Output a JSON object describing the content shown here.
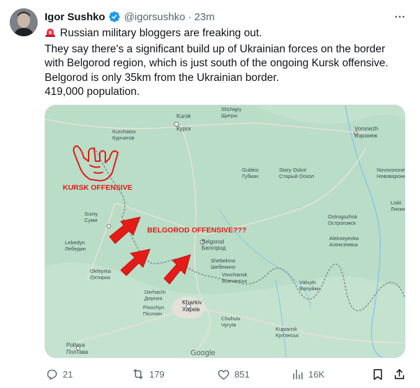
{
  "tweet": {
    "author_name": "Igor Sushko",
    "handle": "@igorsushko",
    "separator": "·",
    "time": "23m",
    "lines": [
      "Russian military bloggers are freaking out.",
      "They say there's a significant build up of Ukrainian forces on the border",
      "with Belgorod region, which is just south of the ongoing Kursk offensive.",
      "Belgorod is only 35km from the Ukrainian border.",
      "419,000 population."
    ]
  },
  "map": {
    "annotations": {
      "kursk": "KURSK OFFENSIVE",
      "belgorod": "BELGOROD OFFENSIVE???"
    },
    "attribution": "Google",
    "places": [
      {
        "id": "shchigry",
        "en": "Shchigry",
        "ru": "Щигры"
      },
      {
        "id": "kursk",
        "en": "Kursk",
        "ru": "Курск"
      },
      {
        "id": "kurchatov",
        "en": "Kurchatov",
        "ru": "Курчатов"
      },
      {
        "id": "voronezh",
        "en": "Voronezh",
        "ru": "Воронеж"
      },
      {
        "id": "gubkin",
        "en": "Gubkin",
        "ru": "Губкин"
      },
      {
        "id": "staryoskol",
        "en": "Stary Oskol",
        "ru": "Старый Оскол"
      },
      {
        "id": "novovoronezh",
        "en": "Novovoronezh",
        "ru": "Нововоронеж"
      },
      {
        "id": "liski",
        "en": "Liski",
        "ru": "Лиски"
      },
      {
        "id": "sumy",
        "en": "Sumy",
        "ru": "Суми"
      },
      {
        "id": "ostrogozhsk",
        "en": "Ostrogozhsk",
        "ru": "Острогожск"
      },
      {
        "id": "lebedyn",
        "en": "Lebedyn",
        "ru": "Лебедин"
      },
      {
        "id": "belgorod",
        "en": "Belgorod",
        "ru": "Белгород"
      },
      {
        "id": "alekseyevka",
        "en": "Alekseyevka",
        "ru": "Алексеевка"
      },
      {
        "id": "shebekino",
        "en": "Shebekino",
        "ru": "Шебекино"
      },
      {
        "id": "okhtyrka",
        "en": "Okhtyrka",
        "ru": "Охтирка"
      },
      {
        "id": "vovchansk",
        "en": "Vovchansk",
        "ru": "Вовчанськ"
      },
      {
        "id": "valuyki",
        "en": "Valuyki",
        "ru": "Валуйки"
      },
      {
        "id": "derhachi",
        "en": "Derhachi",
        "ru": "Дергачі"
      },
      {
        "id": "kharkiv",
        "en": "Kharkiv",
        "ru": "Харків"
      },
      {
        "id": "pisochyn",
        "en": "Pisochyn",
        "ru": "Пісочин"
      },
      {
        "id": "chuhuiv",
        "en": "Chuhuiv",
        "ru": "Чугуїв"
      },
      {
        "id": "kupiansk",
        "en": "Kupiansk",
        "ru": "Куп'янськ"
      },
      {
        "id": "poltava",
        "en": "Poltava",
        "ru": "Полтава"
      }
    ]
  },
  "actions": {
    "replies": "21",
    "reposts": "179",
    "likes": "851",
    "views": "16K"
  },
  "colors": {
    "verified": "#1d9bf0",
    "annotation_red": "#e41b17",
    "map_land": "#b8ddc6",
    "muted": "#536471"
  }
}
